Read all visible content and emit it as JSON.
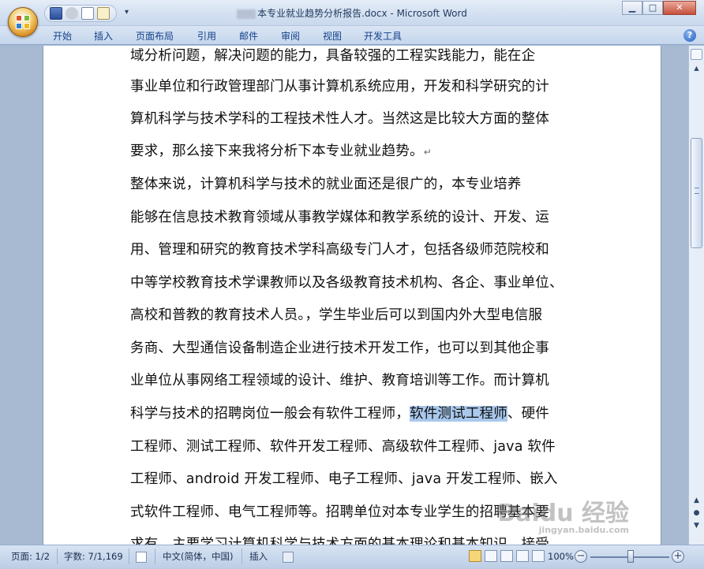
{
  "window": {
    "title": "本专业就业趋势分析报告.docx - Microsoft Word",
    "buttons": {
      "minimize": "▁",
      "maximize": "□",
      "close": "✕"
    }
  },
  "quick_access": {
    "more": "▾"
  },
  "ribbon": {
    "tabs": [
      "开始",
      "插入",
      "页面布局",
      "引用",
      "邮件",
      "审阅",
      "视图",
      "开发工具"
    ],
    "help": "?"
  },
  "document": {
    "lines": [
      {
        "text": "域分析问题，解决问题的能力，具备较强的工程实践能力，能在企"
      },
      {
        "text": "事业单位和行政管理部门从事计算机系统应用，开发和科学研究的计"
      },
      {
        "text": "算机科学与技术学科的工程技术性人才。当然这是比较大方面的整体"
      },
      {
        "text": "要求，那么接下来我将分析下本专业就业趋势。",
        "mark": "↵"
      },
      {
        "text": "    整体来说，计算机科学与技术的就业面还是很广的，本专业培养"
      },
      {
        "text": "能够在信息技术教育领域从事教学媒体和教学系统的设计、开发、运"
      },
      {
        "text": "用、管理和研究的教育技术学科高级专门人才，包括各级师范院校和"
      },
      {
        "text": "中等学校教育技术学课教师以及各级教育技术机构、各企、事业单位、"
      },
      {
        "text": "高校和普教的教育技术人员。，学生毕业后可以到国内外大型电信服"
      },
      {
        "text": "务商、大型通信设备制造企业进行技术开发工作，也可以到其他企事"
      },
      {
        "text": "业单位从事网络工程领域的设计、维护、教育培训等工作。而计算机"
      },
      {
        "text": "科学与技术的招聘岗位一般会有软件工程师，",
        "highlight": "软件测试工程师",
        "after": "、硬件"
      },
      {
        "text": "工程师、测试工程师、软件开发工程师、高级软件工程师、java 软件"
      },
      {
        "text": "工程师、android 开发工程师、电子工程师、java 开发工程师、嵌入"
      },
      {
        "text": "式软件工程师、电气工程师等。招聘单位对本专业学生的招聘基本要"
      },
      {
        "text": "求有，主要学习计算机科学与技术方面的基本理论和基本知识，接受"
      }
    ]
  },
  "watermark": {
    "main": "Baidu 经验",
    "sub": "jingyan.baidu.com"
  },
  "statusbar": {
    "page": "页面: 1/2",
    "words": "字数: 7/1,169",
    "language": "中文(简体，中国)",
    "mode": "插入",
    "zoom": "100%",
    "zoom_out": "−",
    "zoom_in": "+"
  },
  "scrollbar": {
    "up": "▲",
    "down": "▼",
    "prev": "▲",
    "next": "▼"
  }
}
